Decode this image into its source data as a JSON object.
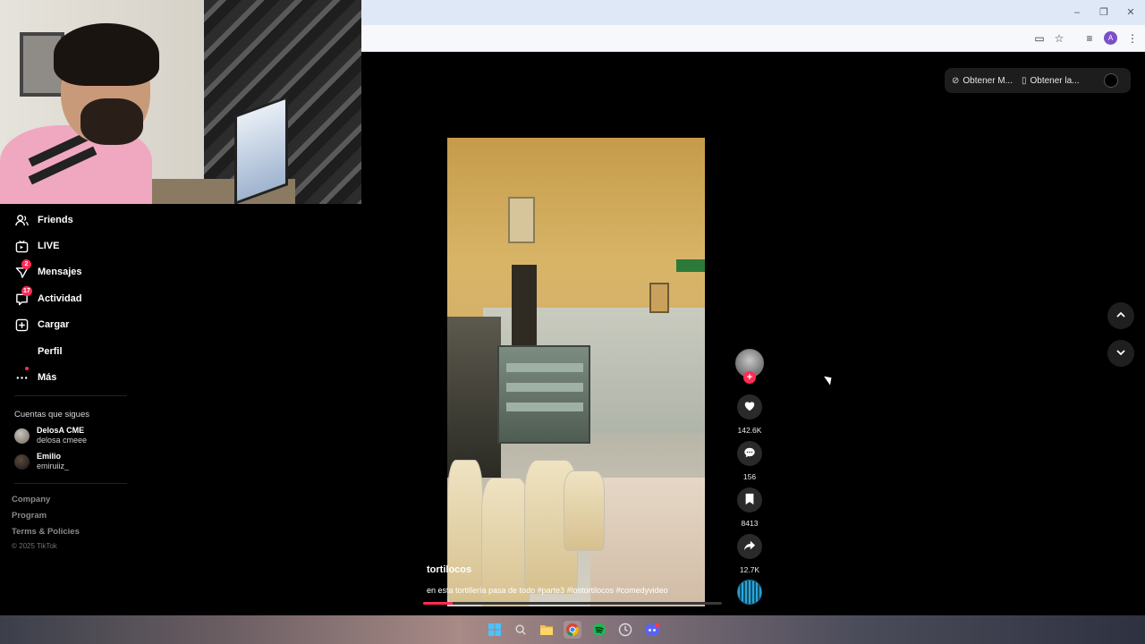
{
  "browser": {
    "extension_pills": [
      {
        "icon": "link-icon",
        "label": "Obtener M..."
      },
      {
        "icon": "phone-icon",
        "label": "Obtener la..."
      }
    ],
    "profile_initial": "A"
  },
  "sidebar": {
    "nav": [
      {
        "label": "Friends",
        "icon": "friends-icon"
      },
      {
        "label": "LIVE",
        "icon": "live-icon"
      },
      {
        "label": "Mensajes",
        "icon": "messages-icon",
        "badge": "2"
      },
      {
        "label": "Actividad",
        "icon": "activity-icon",
        "badge": "17"
      },
      {
        "label": "Cargar",
        "icon": "upload-icon"
      },
      {
        "label": "Perfil",
        "icon": ""
      },
      {
        "label": "Más",
        "icon": "more-icon",
        "dot": true
      }
    ],
    "following_title": "Cuentas que sigues",
    "following": [
      {
        "name": "DelosA CME",
        "handle": "delosa cmeee"
      },
      {
        "name": "Emilio",
        "handle": "emiruiiz_"
      }
    ],
    "footer_links": [
      "Company",
      "Program",
      "Terms & Policies"
    ],
    "copyright": "© 2025 TikTok"
  },
  "video": {
    "author": "tortilocos",
    "caption": "en esta tortillería pasa de todo #parte3 #lostortilocos #comedyvideo",
    "progress_fraction": 0.1
  },
  "actions": {
    "likes": "142.6K",
    "comments": "156",
    "saves": "8413",
    "shares": "12.7K"
  },
  "colors": {
    "accent": "#fe2c55",
    "background": "#000000"
  }
}
